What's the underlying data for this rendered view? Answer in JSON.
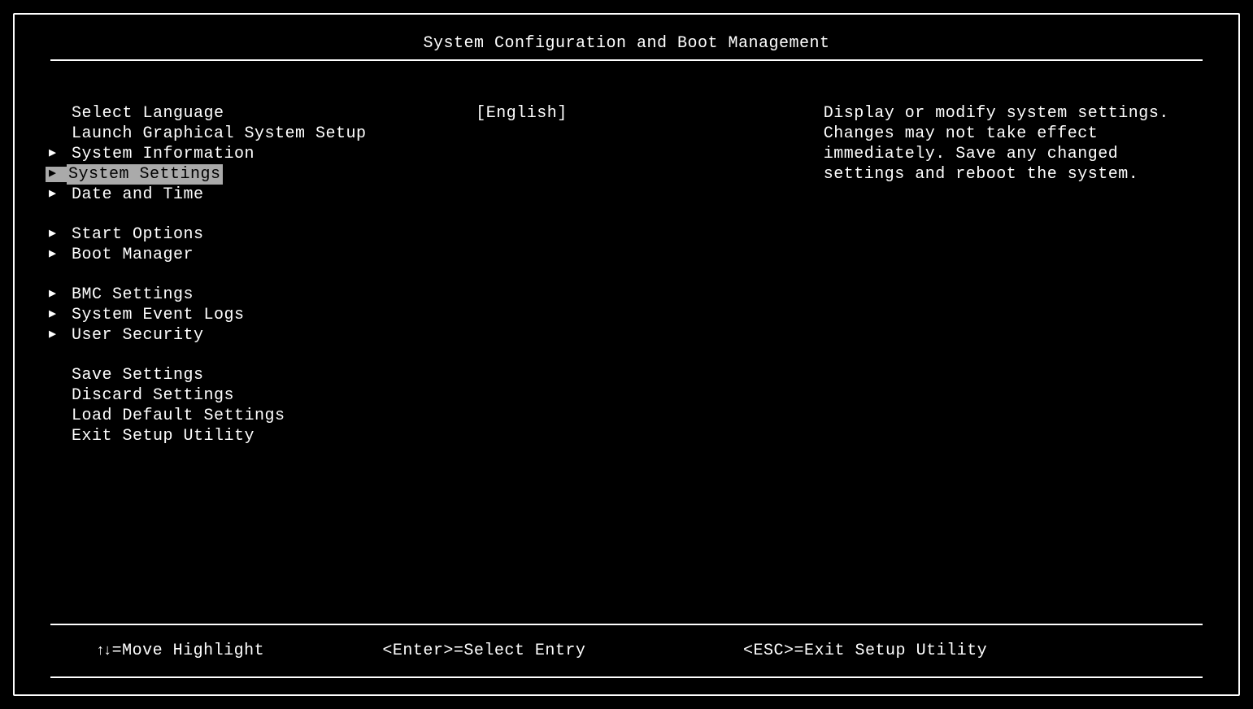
{
  "header": {
    "title": "System Configuration and Boot Management"
  },
  "menu": {
    "group1": [
      {
        "label": "Select Language",
        "value": "[English]",
        "submenu": false,
        "selected": false
      },
      {
        "label": "Launch Graphical System Setup",
        "value": "",
        "submenu": false,
        "selected": false
      },
      {
        "label": "System Information",
        "value": "",
        "submenu": true,
        "selected": false
      },
      {
        "label": "System Settings",
        "value": "",
        "submenu": true,
        "selected": true
      },
      {
        "label": "Date and Time",
        "value": "",
        "submenu": true,
        "selected": false
      }
    ],
    "group2": [
      {
        "label": "Start Options",
        "value": "",
        "submenu": true,
        "selected": false
      },
      {
        "label": "Boot Manager",
        "value": "",
        "submenu": true,
        "selected": false
      }
    ],
    "group3": [
      {
        "label": "BMC Settings",
        "value": "",
        "submenu": true,
        "selected": false
      },
      {
        "label": "System Event Logs",
        "value": "",
        "submenu": true,
        "selected": false
      },
      {
        "label": "User Security",
        "value": "",
        "submenu": true,
        "selected": false
      }
    ],
    "group4": [
      {
        "label": "Save Settings",
        "value": "",
        "submenu": false,
        "selected": false
      },
      {
        "label": "Discard Settings",
        "value": "",
        "submenu": false,
        "selected": false
      },
      {
        "label": "Load Default Settings",
        "value": "",
        "submenu": false,
        "selected": false
      },
      {
        "label": "Exit Setup Utility",
        "value": "",
        "submenu": false,
        "selected": false
      }
    ]
  },
  "help": {
    "text": "Display or modify system settings. Changes may not take effect immediately. Save any changed settings and reboot the system."
  },
  "footer": {
    "move": "=Move Highlight",
    "select": "<Enter>=Select Entry",
    "exit": "<ESC>=Exit Setup Utility"
  },
  "glyphs": {
    "submenu_arrow": "▶",
    "updown": "↑↓"
  }
}
